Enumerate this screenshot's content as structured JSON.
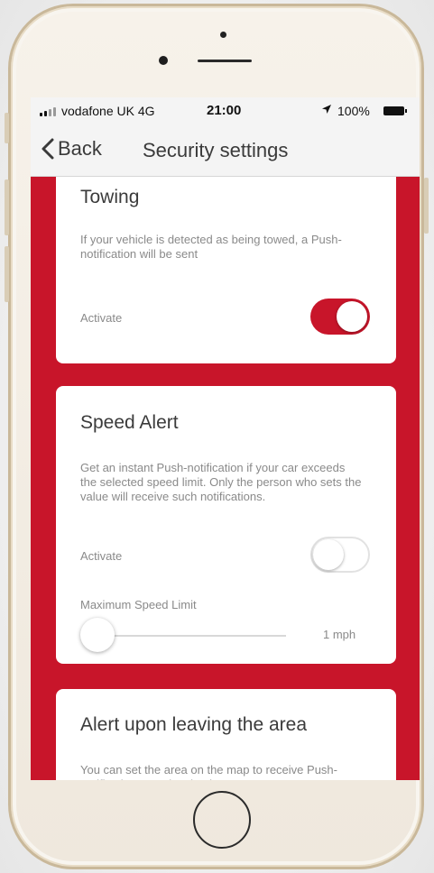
{
  "status_bar": {
    "carrier": "vodafone UK  4G",
    "time": "21:00",
    "battery_text": "100%",
    "location_icon": "location-arrow-icon"
  },
  "nav": {
    "back_label": "Back",
    "title": "Security settings"
  },
  "cards": {
    "towing": {
      "title": "Towing",
      "description": "If your vehicle is detected as being towed, a Push-notification will be sent",
      "activate_label": "Activate",
      "activate_on": true
    },
    "speed_alert": {
      "title": "Speed Alert",
      "description": "Get an instant Push-notification if your car exceeds the selected speed limit. Only the person who sets the value will receive such notifications.",
      "activate_label": "Activate",
      "activate_on": false,
      "limit_label": "Maximum Speed Limit",
      "limit_value": "1 mph",
      "limit_position_fraction": 0
    },
    "leave_area": {
      "title": "Alert upon leaving the area",
      "description": "You can set the area on the map to receive Push-notification upon leaving it"
    }
  },
  "colors": {
    "accent": "#c8152a",
    "card_bg": "#ffffff",
    "nav_bg": "#f4f4f4",
    "phone_frame": "#efe8dd"
  }
}
